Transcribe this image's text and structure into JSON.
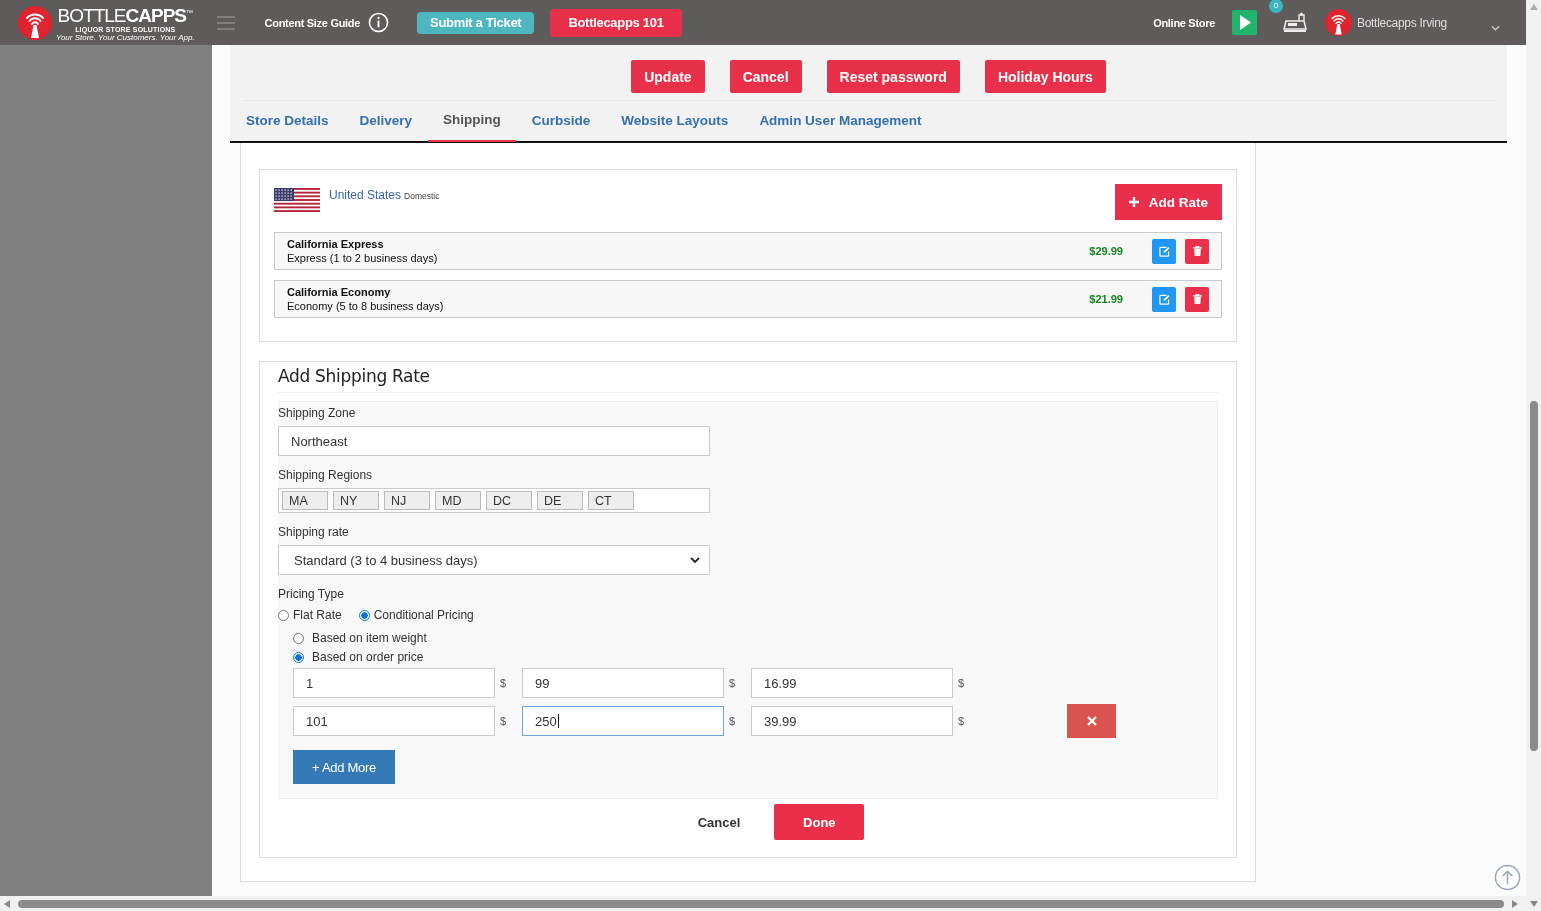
{
  "topbar": {
    "logo": {
      "wordmark": "BOTTLE**CAPPS**$^{™}$",
      "tagline": "LIQUOR STORE SOLUTIONS",
      "slogan": "Your Store. Your Customers. Your App."
    },
    "guide_link": "Content Size Guide",
    "buttons": [
      {
        "label": "Submit a Ticket",
        "kind": "teal"
      },
      {
        "label": "Bottlecapps 101",
        "kind": "red"
      }
    ],
    "online_store": "Online Store",
    "notification_count": "0",
    "user": "Bottlecapps Irving"
  },
  "toolbar": {
    "buttons": [
      "Update",
      "Cancel",
      "Reset password",
      "Holiday Hours"
    ]
  },
  "tabs": [
    {
      "label": "Store Details",
      "selected": false
    },
    {
      "label": "Delivery",
      "selected": false
    },
    {
      "label": "Shipping",
      "selected": true
    },
    {
      "label": "Curbside",
      "selected": false
    },
    {
      "label": "Website Layouts",
      "selected": false
    },
    {
      "label": "Admin User Management",
      "selected": false
    }
  ],
  "domestic": {
    "country": "United States",
    "scope": "Domestic",
    "add_button": "Add Rate",
    "rates": [
      {
        "name": "California Express",
        "description": "Express (1 to 2 business days)",
        "price": "$29.99"
      },
      {
        "name": "California Economy",
        "description": "Economy (5 to 8 business days)",
        "price": "$21.99"
      }
    ]
  },
  "add_form": {
    "title": "Add Shipping Rate",
    "zone": {
      "label": "Shipping Zone",
      "value": "Northeast"
    },
    "regions": {
      "label": "Shipping Regions",
      "tags": [
        "MA",
        "NY",
        "NJ",
        "MD",
        "DC",
        "DE",
        "CT"
      ]
    },
    "rate": {
      "label": "Shipping rate",
      "value": "Standard (3 to 4 business days)"
    },
    "pricing_type": {
      "label": "Pricing Type",
      "options": [
        {
          "label": "Flat Rate",
          "selected": false
        },
        {
          "label": "Conditional Pricing",
          "selected": true
        }
      ]
    },
    "basis": [
      {
        "label": "Based on item weight",
        "selected": false
      },
      {
        "label": "Based on order price",
        "selected": true
      }
    ],
    "tiers": [
      {
        "removable": false,
        "fields": [
          {
            "value": "1",
            "unit": "$",
            "focused": false
          },
          {
            "value": "99",
            "unit": "$",
            "focused": false
          },
          {
            "value": "16.99",
            "unit": "$",
            "focused": false
          }
        ]
      },
      {
        "removable": true,
        "fields": [
          {
            "value": "101",
            "unit": "$",
            "focused": false
          },
          {
            "value": "250",
            "unit": "$",
            "focused": true
          },
          {
            "value": "39.99",
            "unit": "$",
            "focused": false
          }
        ]
      }
    ],
    "add_more": "+ Add More",
    "cancel": "Cancel",
    "done": "Done"
  }
}
